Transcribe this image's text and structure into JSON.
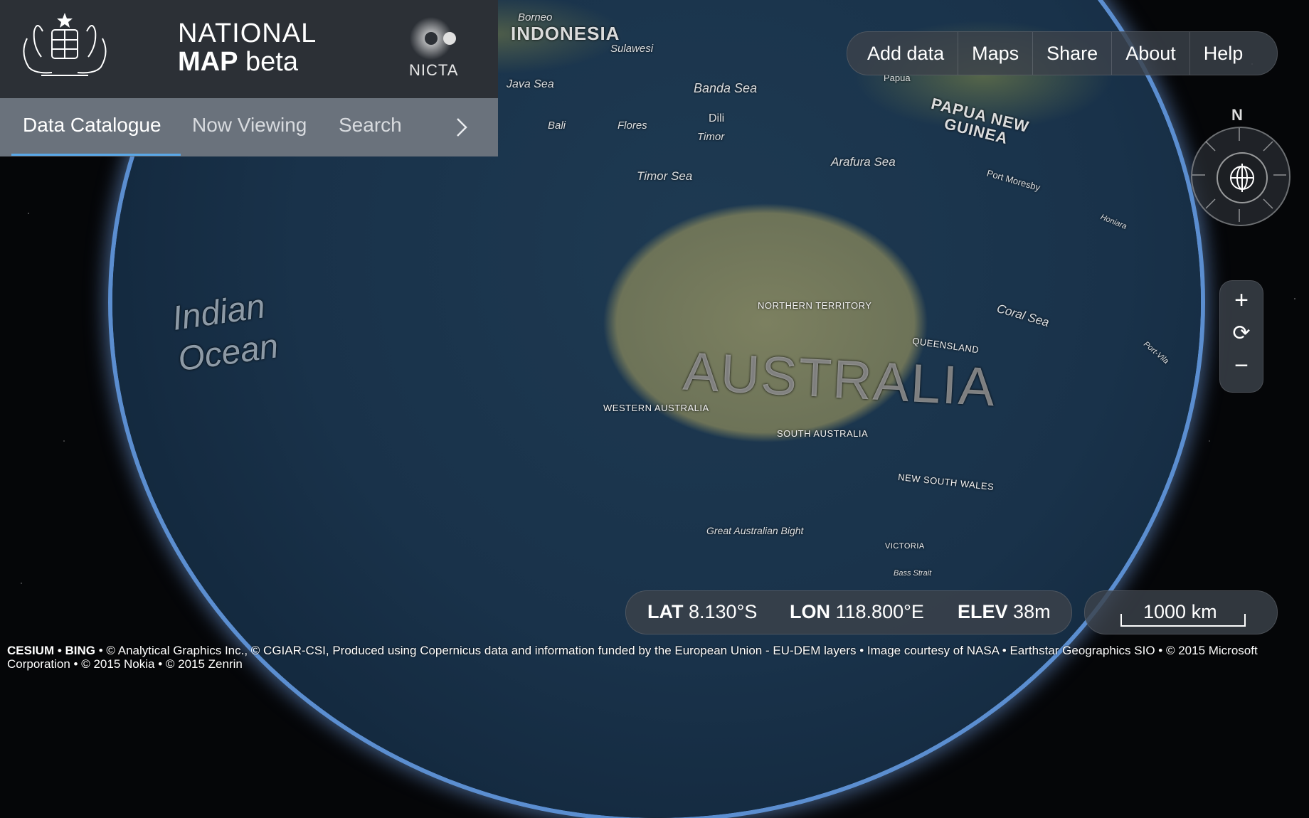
{
  "header": {
    "title_line1": "NATIONAL",
    "title_bold": "MAP",
    "title_suffix": "beta",
    "partner": "NICTA"
  },
  "tabs": [
    {
      "label": "Data Catalogue",
      "active": true
    },
    {
      "label": "Now Viewing",
      "active": false
    },
    {
      "label": "Search",
      "active": false
    }
  ],
  "tabs_next_icon": "chevron-right-icon",
  "menu": [
    "Add data",
    "Maps",
    "Share",
    "About",
    "Help"
  ],
  "compass": {
    "north_label": "N"
  },
  "zoom": {
    "in": "+",
    "reset": "⟳",
    "out": "−"
  },
  "status": {
    "lat_label": "LAT",
    "lat_value": "8.130°S",
    "lon_label": "LON",
    "lon_value": "118.800°E",
    "elev_label": "ELEV",
    "elev_value": "38m"
  },
  "scale": {
    "label": "1000 km"
  },
  "credits": {
    "prefix": "CESIUM • BING",
    "text": " • © Analytical Graphics Inc., © CGIAR-CSI, Produced using Copernicus data and information funded by the European Union - EU-DEM layers • Image courtesy of NASA • Earthstar Geographics SIO • © 2015 Microsoft Corporation • © 2015 Nokia • © 2015 Zenrin"
  },
  "map_labels": {
    "indonesia": "INDONESIA",
    "borneo": "Borneo",
    "sulawesi": "Sulawesi",
    "java_sea": "Java Sea",
    "banda_sea": "Banda Sea",
    "bali": "Bali",
    "flores": "Flores",
    "dili": "Dili",
    "timor": "Timor",
    "timor_sea": "Timor Sea",
    "arafura_sea": "Arafura Sea",
    "papua": "Papua",
    "png": "PAPUA NEW GUINEA",
    "port_moresby": "Port Moresby",
    "honiara": "Honiara",
    "port_vila": "Port-Vila",
    "coral_sea": "Coral Sea",
    "northern_territory": "Northern Territory",
    "queensland": "Queensland",
    "western_australia": "Western Australia",
    "south_australia": "South Australia",
    "new_south_wales": "New South Wales",
    "victoria": "Victoria",
    "australia": "AUSTRALIA",
    "indian_ocean_1": "Indian",
    "indian_ocean_2": "Ocean",
    "great_australian_bight": "Great Australian Bight",
    "bass_strait": "Bass Strait"
  }
}
